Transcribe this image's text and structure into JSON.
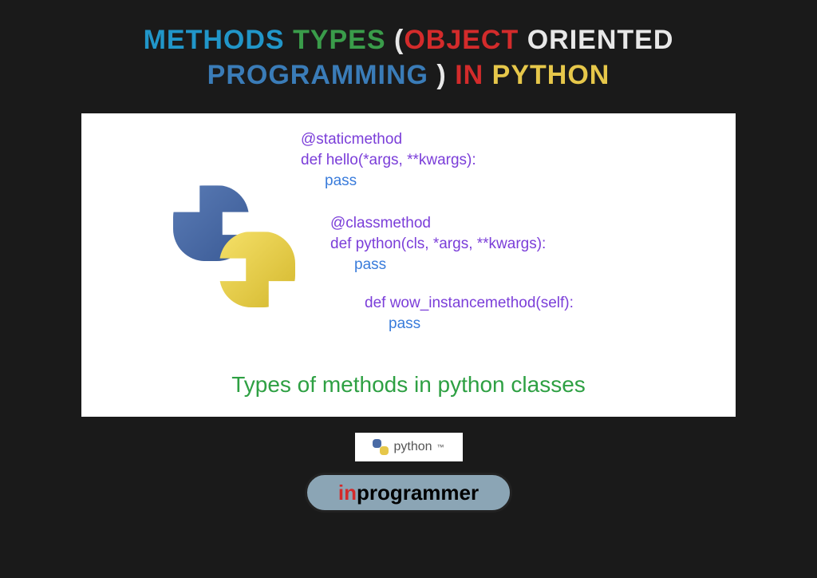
{
  "title": {
    "w1": "METHODS",
    "w2": "TYPES",
    "w3": "(",
    "w4": "OBJECT",
    "w5": "ORIENTED",
    "w6": "PROGRAMMING",
    "w7": ")",
    "w8": "IN",
    "w9": "PYTHON"
  },
  "code": {
    "static_decorator": "@staticmethod",
    "static_def": "def hello(*args, **kwargs):",
    "static_body": "pass",
    "class_decorator": "@classmethod",
    "class_def": "def python(cls, *args, **kwargs):",
    "class_body": "pass",
    "instance_def": "def wow_instancemethod(self):",
    "instance_body": "pass"
  },
  "caption": "Types of methods in python classes",
  "badge": {
    "label": "python",
    "tm": "™"
  },
  "brand": {
    "prefix": "in",
    "suffix": "programmer"
  }
}
